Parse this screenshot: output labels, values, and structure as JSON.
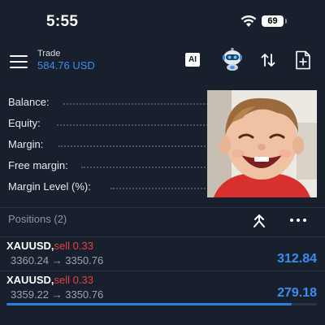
{
  "status_bar": {
    "time": "5:55",
    "battery": "69"
  },
  "header": {
    "title": "Trade",
    "balance": "584.76 USD",
    "ai_label": "AI",
    "icons": [
      "menu-icon",
      "robot-icon",
      "sort-icon",
      "new-document-icon"
    ]
  },
  "metrics": [
    {
      "label": "Balance:"
    },
    {
      "label": "Equity:"
    },
    {
      "label": "Margin:"
    },
    {
      "label": "Free margin:"
    },
    {
      "label": "Margin Level (%):"
    }
  ],
  "positions": {
    "title": "Positions (2)",
    "items": [
      {
        "symbol": "XAUUSD",
        "side": "sell 0.33",
        "open_price": "3360.24",
        "current_price": "3350.76",
        "profit": "312.84"
      },
      {
        "symbol": "XAUUSD",
        "side": "sell 0.33",
        "open_price": "3359.22",
        "current_price": "3350.76",
        "profit": "279.18"
      }
    ]
  },
  "scroll_progress": 0.92,
  "colors": {
    "background": "#18202d",
    "accent_blue": "#3b8df0",
    "sell_red": "#e9413e",
    "muted_text": "#9aa3b0"
  }
}
